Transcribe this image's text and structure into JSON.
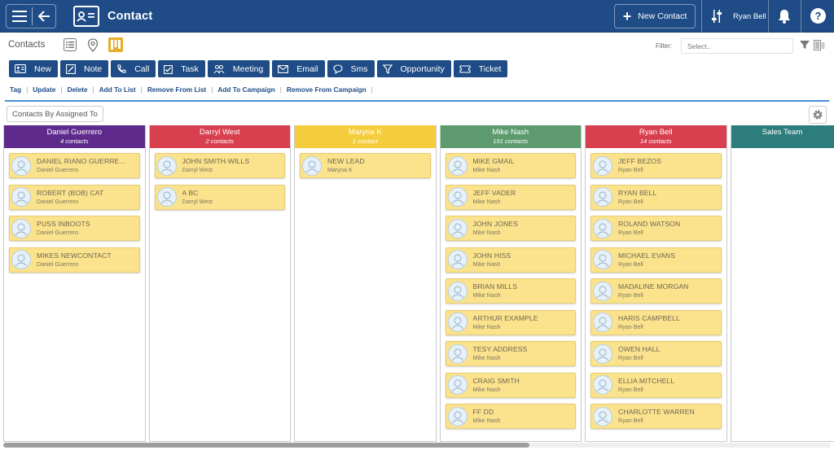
{
  "header": {
    "app_title": "Contact",
    "menu_icon": "hamburger-icon",
    "back_icon": "arrow-left-icon",
    "app_icon": "contact-card-icon",
    "new_contact_label": "New Contact",
    "user_name": "Ryan Bell",
    "bg_color": "#1f4c86"
  },
  "subheader": {
    "contacts_label": "Contacts",
    "view_icons": [
      "list-view-icon",
      "map-pin-icon",
      "board-view-icon"
    ],
    "active_view": "board-view-icon",
    "filter_label": "Filter:",
    "filter_placeholder": "Select.."
  },
  "actions": [
    {
      "label": "New",
      "icon": "contact-card-icon"
    },
    {
      "label": "Note",
      "icon": "note-icon"
    },
    {
      "label": "Call",
      "icon": "phone-icon"
    },
    {
      "label": "Task",
      "icon": "task-icon"
    },
    {
      "label": "Meeting",
      "icon": "meeting-icon"
    },
    {
      "label": "Email",
      "icon": "envelope-icon"
    },
    {
      "label": "Sms",
      "icon": "chat-bubble-icon"
    },
    {
      "label": "Opportunity",
      "icon": "funnel-icon"
    },
    {
      "label": "Ticket",
      "icon": "ticket-icon"
    }
  ],
  "links": [
    "Tag",
    "Update",
    "Delete",
    "Add To List",
    "Remove From List",
    "Add To Campaign",
    "Remove From Campaign"
  ],
  "groupby_label": "Contacts By Assigned To",
  "columns": [
    {
      "name": "Daniel Guerrero",
      "count": "4 contacts",
      "color": "#5e2b8c",
      "cards": [
        {
          "name": "DANIEL RIANO GUERRE...",
          "owner": "Daniel Guerrero"
        },
        {
          "name": "ROBERT (BOB) CAT",
          "owner": "Daniel Guerrero"
        },
        {
          "name": "PUSS INBOOTS",
          "owner": "Daniel Guerrero"
        },
        {
          "name": "MIKES NEWCONTACT",
          "owner": "Daniel Guerrero"
        }
      ]
    },
    {
      "name": "Darryl West",
      "count": "2 contacts",
      "color": "#d9404f",
      "cards": [
        {
          "name": "JOHN SMITH-WILLS",
          "owner": "Darryl West"
        },
        {
          "name": "A BC",
          "owner": "Darryl West"
        }
      ]
    },
    {
      "name": "Maryna K",
      "count": "1 contact",
      "color": "#f4cd3c",
      "cards": [
        {
          "name": "NEW LEAD",
          "owner": "Maryna K"
        }
      ]
    },
    {
      "name": "Mike Nash",
      "count": "151 contacts",
      "color": "#5d9a6e",
      "cards": [
        {
          "name": "MIKE GMAIL",
          "owner": "Mike Nash"
        },
        {
          "name": "JEFF VADER",
          "owner": "Mike Nash"
        },
        {
          "name": "JOHN JONES",
          "owner": "Mike Nash"
        },
        {
          "name": "JOHN HISS",
          "owner": "Mike Nash"
        },
        {
          "name": "BRIAN MILLS",
          "owner": "Mike Nash"
        },
        {
          "name": "ARTHUR EXAMPLE",
          "owner": "Mike Nash"
        },
        {
          "name": "TESY ADDRESS",
          "owner": "Mike Nash"
        },
        {
          "name": "CRAIG SMITH",
          "owner": "Mike Nash"
        },
        {
          "name": "FF DD",
          "owner": "Mike Nash"
        }
      ]
    },
    {
      "name": "Ryan Bell",
      "count": "14 contacts",
      "color": "#d9404f",
      "cards": [
        {
          "name": "JEFF BEZOS",
          "owner": "Ryan Bell"
        },
        {
          "name": "RYAN BELL",
          "owner": "Ryan Bell"
        },
        {
          "name": "ROLAND WATSON",
          "owner": "Ryan Bell"
        },
        {
          "name": "MICHAEL EVANS",
          "owner": "Ryan Bell"
        },
        {
          "name": "MADALINE MORGAN",
          "owner": "Ryan Bell"
        },
        {
          "name": "HARIS CAMPBELL",
          "owner": "Ryan Bell"
        },
        {
          "name": "OWEN HALL",
          "owner": "Ryan Bell"
        },
        {
          "name": "ELLIA MITCHELL",
          "owner": "Ryan Bell"
        },
        {
          "name": "CHARLOTTE WARREN",
          "owner": "Ryan Bell"
        }
      ]
    },
    {
      "name": "Sales Team",
      "count": "",
      "color": "#2e7d7d",
      "cards": []
    }
  ],
  "scrollbar_position": 0.64,
  "card_color": "#fbe38d"
}
